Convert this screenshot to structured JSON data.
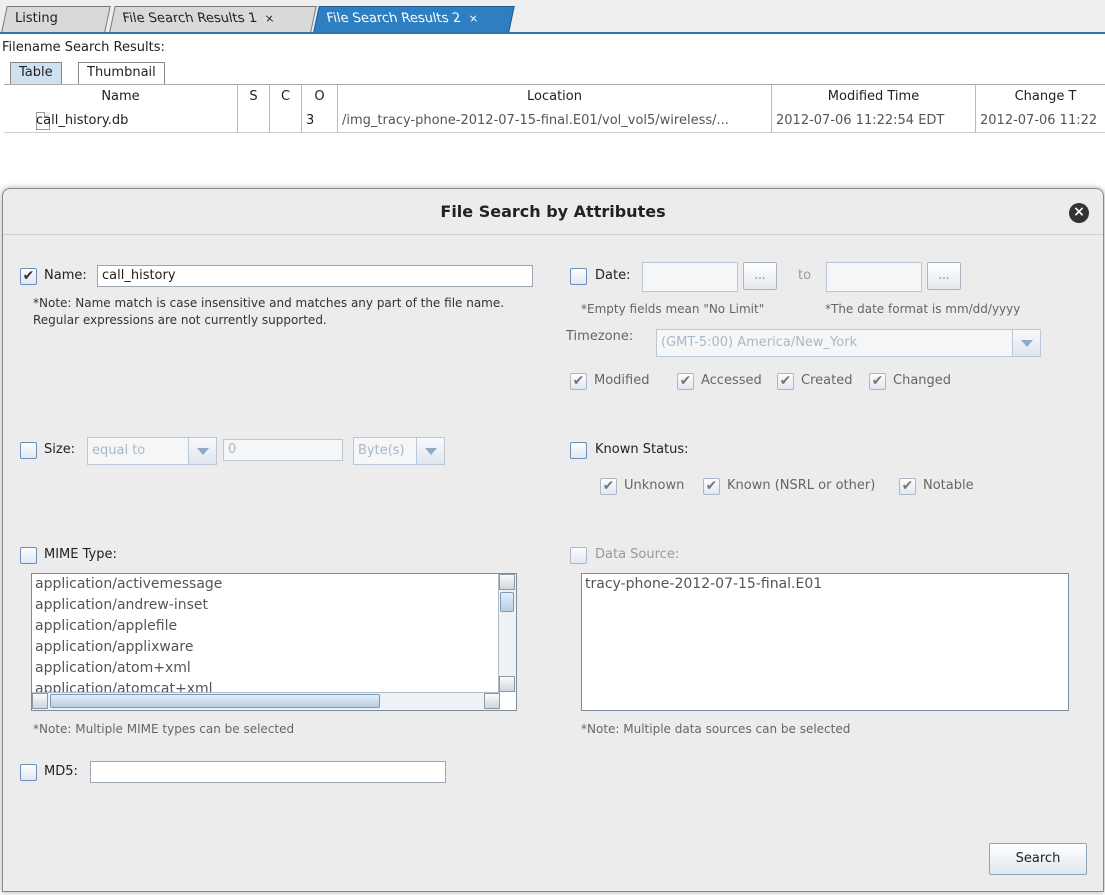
{
  "tabs": [
    {
      "label": "Listing"
    },
    {
      "label": "File Search Results 1",
      "close": "×"
    },
    {
      "label": "File Search Results 2",
      "close": "×"
    }
  ],
  "results": {
    "label": "Filename Search Results:",
    "view_tabs": [
      "Table",
      "Thumbnail"
    ],
    "columns": [
      "Name",
      "S",
      "C",
      "O",
      "Location",
      "Modified Time",
      "Change T"
    ],
    "rows": [
      {
        "name": "call_history.db",
        "s": "",
        "c": "",
        "o": "3",
        "location": "/img_tracy-phone-2012-07-15-final.E01/vol_vol5/wireless/...",
        "modified": "2012-07-06 11:22:54 EDT",
        "change": "2012-07-06 11:22"
      }
    ]
  },
  "dialog": {
    "title": "File Search by Attributes",
    "name": {
      "label": "Name:",
      "checked": true,
      "value": "call_history",
      "note": "*Note: Name match is case insensitive and matches any part of the file name. Regular expressions are not currently supported."
    },
    "date": {
      "label": "Date:",
      "checked": false,
      "to_label": "to",
      "browse": "...",
      "note_empty": "*Empty fields mean \"No Limit\"",
      "note_format": "*The date format is mm/dd/yyyy",
      "timezone_label": "Timezone:",
      "timezone_value": "(GMT-5:00) America/New_York",
      "options": [
        {
          "label": "Modified",
          "checked": true
        },
        {
          "label": "Accessed",
          "checked": true
        },
        {
          "label": "Created",
          "checked": true
        },
        {
          "label": "Changed",
          "checked": true
        }
      ]
    },
    "size": {
      "label": "Size:",
      "checked": false,
      "comparator": "equal to",
      "value": "0",
      "unit": "Byte(s)"
    },
    "known_status": {
      "label": "Known Status:",
      "checked": false,
      "options": [
        {
          "label": "Unknown",
          "checked": true
        },
        {
          "label": "Known (NSRL or other)",
          "checked": true
        },
        {
          "label": "Notable",
          "checked": true
        }
      ]
    },
    "mime": {
      "label": "MIME Type:",
      "checked": false,
      "items": [
        "application/activemessage",
        "application/andrew-inset",
        "application/applefile",
        "application/applixware",
        "application/atom+xml",
        "application/atomcat+xml"
      ],
      "note": "*Note: Multiple MIME types can be selected"
    },
    "data_source": {
      "label": "Data Source:",
      "checked": false,
      "items": [
        "tracy-phone-2012-07-15-final.E01"
      ],
      "note": "*Note: Multiple data sources can be selected"
    },
    "md5": {
      "label": "MD5:",
      "checked": false,
      "value": ""
    },
    "search_label": "Search",
    "close_glyph": "×"
  },
  "colors": {
    "accent": "#2e7fc2",
    "dialog_bg": "#ececec"
  }
}
